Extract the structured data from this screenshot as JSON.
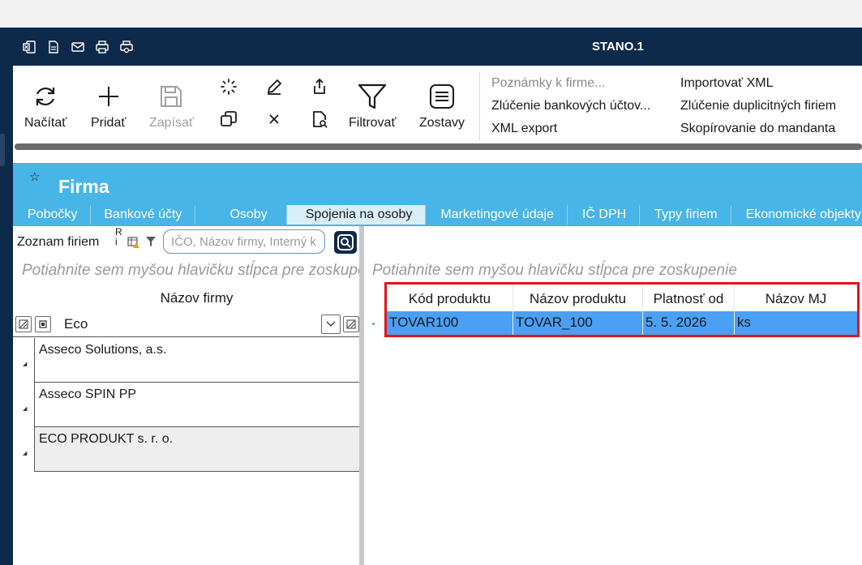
{
  "window": {
    "title": "STANO.1"
  },
  "titlebar_icons": [
    "excel-icon",
    "document-icon",
    "mail-icon",
    "printer-icon",
    "print-preview-icon"
  ],
  "ribbon": {
    "refresh_label": "Načítať",
    "add_label": "Pridať",
    "save_label": "Zapísať",
    "filter_label": "Filtrovať",
    "reports_label": "Zostavy",
    "links": {
      "notes": "Poznámky k firme...",
      "merge_bank": "Zlúčenie bankových účtov...",
      "xml_export": "XML export",
      "import_xml": "Importovať XML",
      "merge_duplicates": "Zlúčenie duplicitných firiem",
      "copy_to_mandant": "Skopírovanie do mandanta"
    }
  },
  "header": {
    "title": "Firma",
    "tabs": [
      "Pobočky",
      "Bankové účty",
      "Osoby",
      "Spojenia na osoby",
      "Marketingové údaje",
      "IČ DPH",
      "Typy firiem",
      "Ekonomické objekty"
    ],
    "active_tab": "Spojenia na osoby"
  },
  "toolbar": {
    "list_label": "Zoznam firiem",
    "ri_label_1": "R",
    "ri_label_2": "i",
    "search_placeholder": "IČO, Názov firmy, Interný k"
  },
  "left_grid": {
    "group_hint": "Potiahnite sem myšou hlavičku stĺpca pre zoskupenie",
    "column": "Názov firmy",
    "filter_value": "Eco",
    "rows": [
      "Asseco Solutions, a.s.",
      "Asseco SPIN PP",
      "ECO PRODUKT s. r. o."
    ]
  },
  "right_grid": {
    "group_hint": "Potiahnite sem myšou hlavičku stĺpca pre zoskupenie",
    "columns": [
      "Kód produktu",
      "Názov produktu",
      "Platnosť od",
      "Názov MJ"
    ],
    "rows": [
      {
        "code": "TOVAR100",
        "name": "TOVAR_100",
        "valid_from": "5. 5. 2026",
        "unit": "ks"
      }
    ]
  },
  "colors": {
    "titlebar": "#0e2a4a",
    "header": "#47b5e7",
    "selection": "#4aa0f5",
    "highlight": "#e3141b"
  }
}
